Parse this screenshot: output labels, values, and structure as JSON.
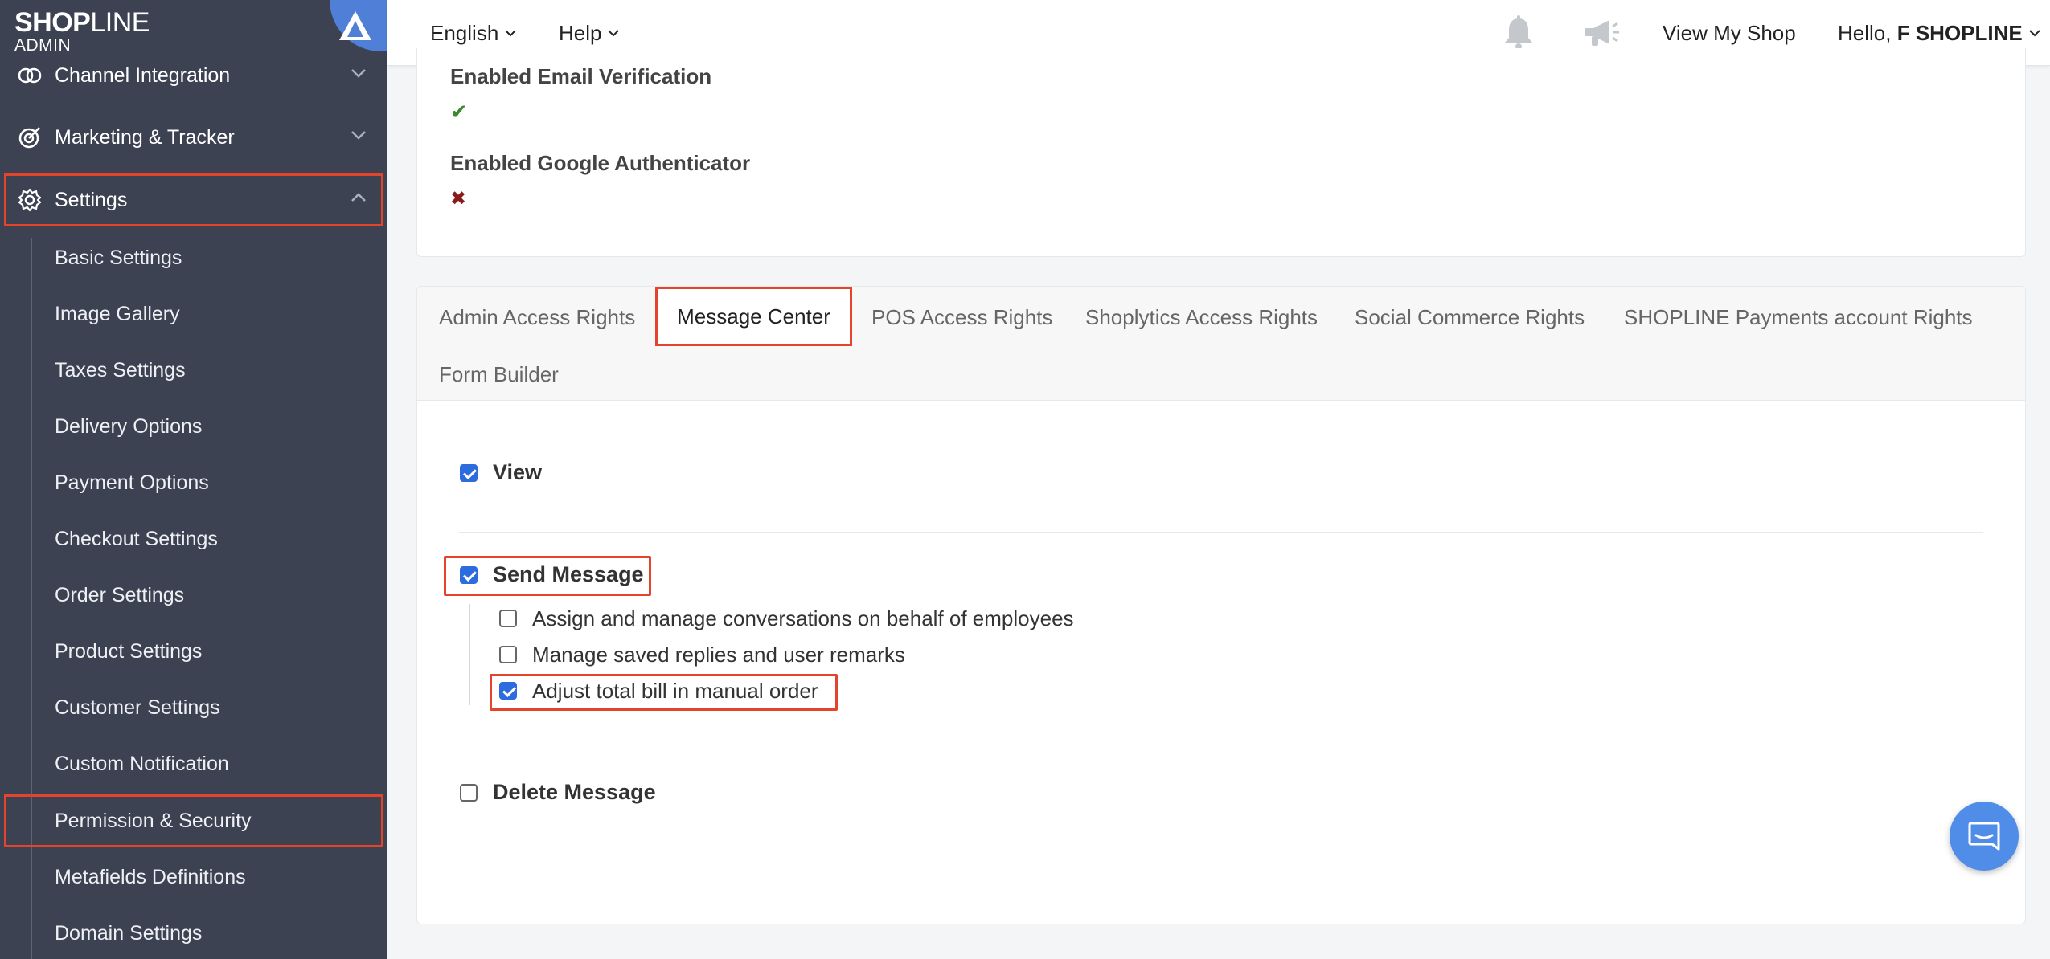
{
  "sidebar": {
    "logo": {
      "brand_bold": "SHOP",
      "brand_thin": "LINE",
      "sub": "ADMIN"
    },
    "nav": [
      {
        "label": "Channel Integration",
        "icon": "link-rings-icon"
      },
      {
        "label": "Marketing & Tracker",
        "icon": "target-icon"
      },
      {
        "label": "Settings",
        "icon": "gear-icon"
      }
    ],
    "settings_items": [
      "Basic Settings",
      "Image Gallery",
      "Taxes Settings",
      "Delivery Options",
      "Payment Options",
      "Checkout Settings",
      "Order Settings",
      "Product Settings",
      "Customer Settings",
      "Custom Notification",
      "Permission & Security",
      "Metafields Definitions",
      "Domain Settings"
    ]
  },
  "header": {
    "language": "English",
    "help": "Help",
    "view_shop": "View My Shop",
    "hello_prefix": "Hello,",
    "user_name": "F SHOPLINE"
  },
  "security": {
    "email_label": "Enabled Email Verification",
    "email_mark": "✔",
    "google_label": "Enabled Google Authenticator",
    "google_mark": "✖",
    "colors": {
      "check": "#3a8a2e",
      "cross": "#8b1a1a"
    }
  },
  "tabs": [
    "Admin Access Rights",
    "Message Center",
    "POS Access Rights",
    "Shoplytics Access Rights",
    "Social Commerce Rights",
    "SHOPLINE Payments account Rights",
    "Form Builder"
  ],
  "active_tab": "Message Center",
  "permissions": {
    "view": {
      "label": "View",
      "checked": true
    },
    "send": {
      "label": "Send Message",
      "checked": true,
      "children": [
        {
          "label": "Assign and manage conversations on behalf of employees",
          "checked": false
        },
        {
          "label": "Manage saved replies and user remarks",
          "checked": false
        },
        {
          "label": "Adjust total bill in manual order",
          "checked": true
        }
      ]
    },
    "delete": {
      "label": "Delete Message",
      "checked": false
    }
  },
  "accent_color": "#2d6cdf",
  "highlight_color": "#e2442c"
}
